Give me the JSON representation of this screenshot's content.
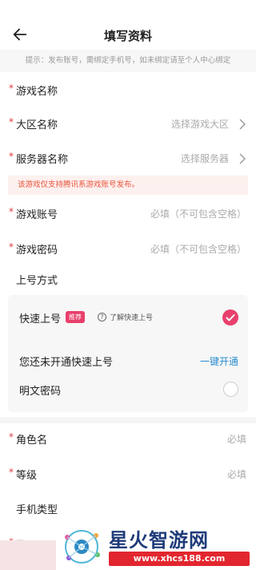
{
  "header": {
    "title": "填写资料",
    "back_icon": "arrow-left-icon"
  },
  "tip": "提示：发布账号，需绑定手机号，如未绑定请至个人中心绑定",
  "fields": {
    "game_name": {
      "label": "游戏名称",
      "required": true
    },
    "region": {
      "label": "大区名称",
      "placeholder": "选择游戏大区",
      "required": true
    },
    "server": {
      "label": "服务器名称",
      "placeholder": "选择服务器",
      "required": true
    },
    "game_account": {
      "label": "游戏账号",
      "placeholder": "必填（不可包含空格）",
      "required": true
    },
    "game_password": {
      "label": "游戏密码",
      "placeholder": "必填（不可包含空格）",
      "required": true
    },
    "login_method": {
      "label": "上号方式"
    },
    "role_name": {
      "label": "角色名",
      "placeholder": "必填",
      "required": true
    },
    "level": {
      "label": "等级",
      "placeholder": "必填",
      "required": true
    },
    "phone_type": {
      "label": "手机类型"
    },
    "partial": {
      "label": "数…"
    }
  },
  "warning": "该游戏仅支持腾讯系游戏账号发布。",
  "login_card": {
    "quick_login_label": "快速上号",
    "badge": "推荐",
    "help_text": "了解快速上号",
    "quick_login_checked": true,
    "not_enabled_text": "您还未开通快速上号",
    "enable_link": "一键开通",
    "plain_password_label": "明文密码",
    "plain_password_checked": false
  },
  "watermark": {
    "title": "星火智游网",
    "url": "www.xhcs188.com"
  },
  "colors": {
    "accent": "#e8406c",
    "link": "#2a8ccf",
    "required": "#e23b3b",
    "warning": "#e9533a"
  }
}
